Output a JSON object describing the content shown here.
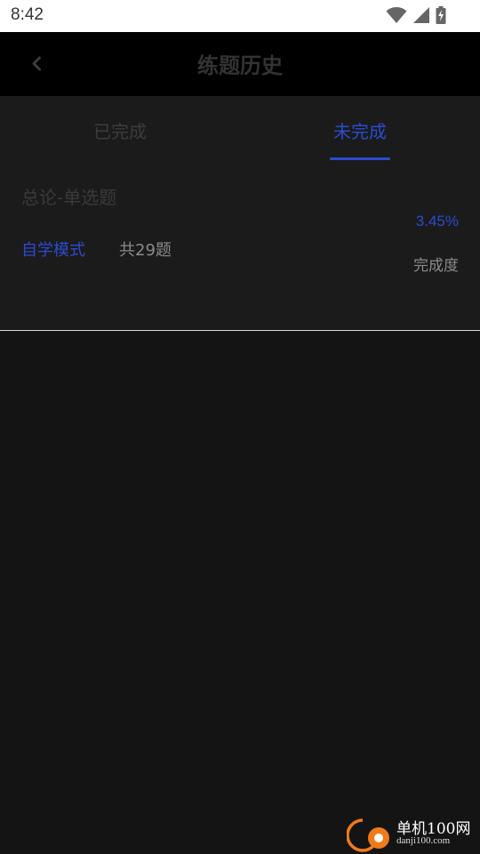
{
  "status_bar": {
    "time": "8:42",
    "icons": [
      "wifi-icon",
      "signal-icon",
      "battery-charging-icon"
    ]
  },
  "nav": {
    "title": "练题历史",
    "back_icon": "chevron-left-icon"
  },
  "tabs": [
    {
      "label": "已完成",
      "active": false
    },
    {
      "label": "未完成",
      "active": true
    }
  ],
  "records": [
    {
      "title": "总论-单选题",
      "mode": "自学模式",
      "total": "共29题",
      "completion_percent": "3.45%",
      "completion_label": "完成度"
    }
  ],
  "colors": {
    "accent": "#2b4bd1",
    "background": "#141414",
    "card": "#1b1b1b",
    "nav": "#000000"
  },
  "watermark": {
    "main": "单机100网",
    "sub": "danji100.com"
  }
}
